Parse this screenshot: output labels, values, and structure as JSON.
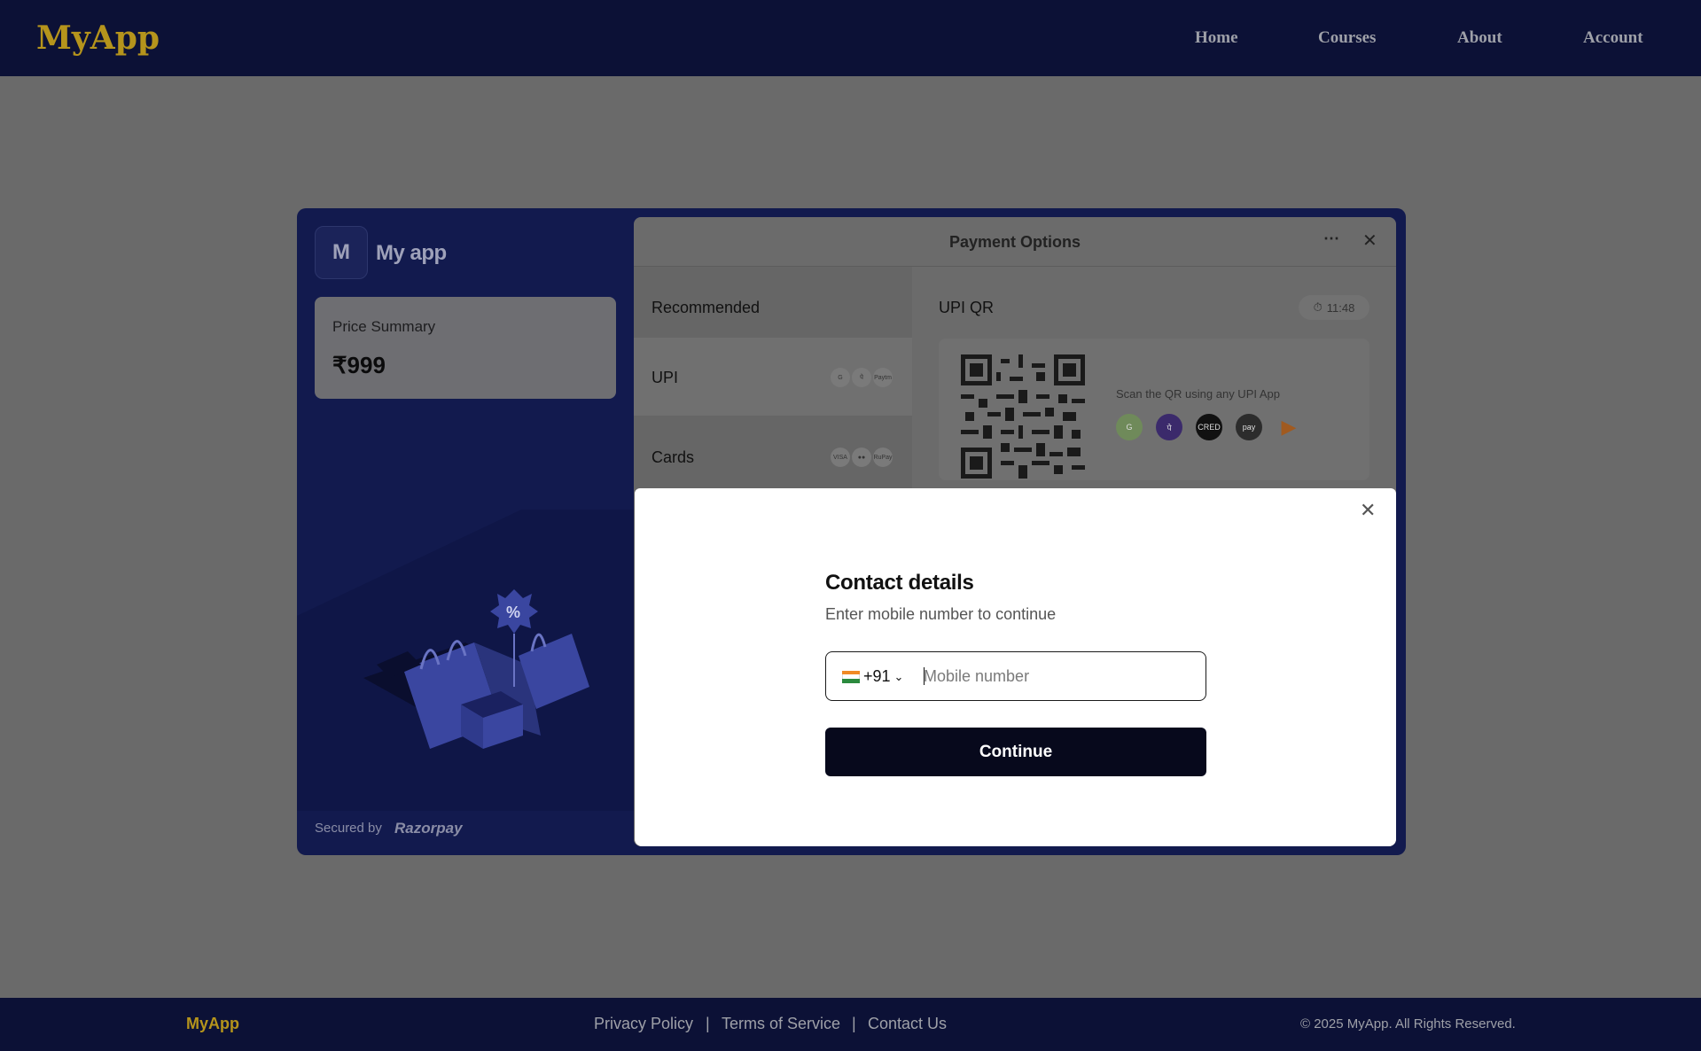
{
  "header": {
    "brand": "MyApp",
    "nav": [
      "Home",
      "Courses",
      "About",
      "Account"
    ]
  },
  "checkout": {
    "merchant_initial": "M",
    "merchant_name": "My app",
    "price_summary_label": "Price Summary",
    "price": "₹999",
    "secured_by": "Secured by",
    "provider": "Razorpay",
    "panel_title": "Payment Options",
    "recommended": "Recommended",
    "methods": [
      "UPI",
      "Cards"
    ],
    "upi_icons": [
      "gpay-icon",
      "phonepe-icon",
      "paytm-icon"
    ],
    "card_icons": [
      "visa-icon",
      "mastercard-icon",
      "rupay-icon"
    ],
    "upi_qr_label": "UPI QR",
    "timer": "11:48",
    "scan_text": "Scan the QR using any UPI App",
    "upi_apps": [
      "gpay-icon",
      "phonepe-icon",
      "cred-icon",
      "amazonpay-icon",
      "bhim-icon"
    ]
  },
  "contact_dialog": {
    "title": "Contact details",
    "subtitle": "Enter mobile number to continue",
    "country_code": "+91",
    "phone_placeholder": "Mobile number",
    "phone_value": "",
    "continue_label": "Continue"
  },
  "footer": {
    "brand": "MyApp",
    "links": [
      "Privacy Policy",
      "Terms of Service",
      "Contact Us"
    ],
    "separator": "|",
    "copyright": "© 2025 MyApp. All Rights Reserved."
  },
  "colors": {
    "navbar": "#0c1136",
    "brand_gold": "#b5941c",
    "checkout_bg": "#121a4e",
    "continue_button": "#07091c"
  }
}
